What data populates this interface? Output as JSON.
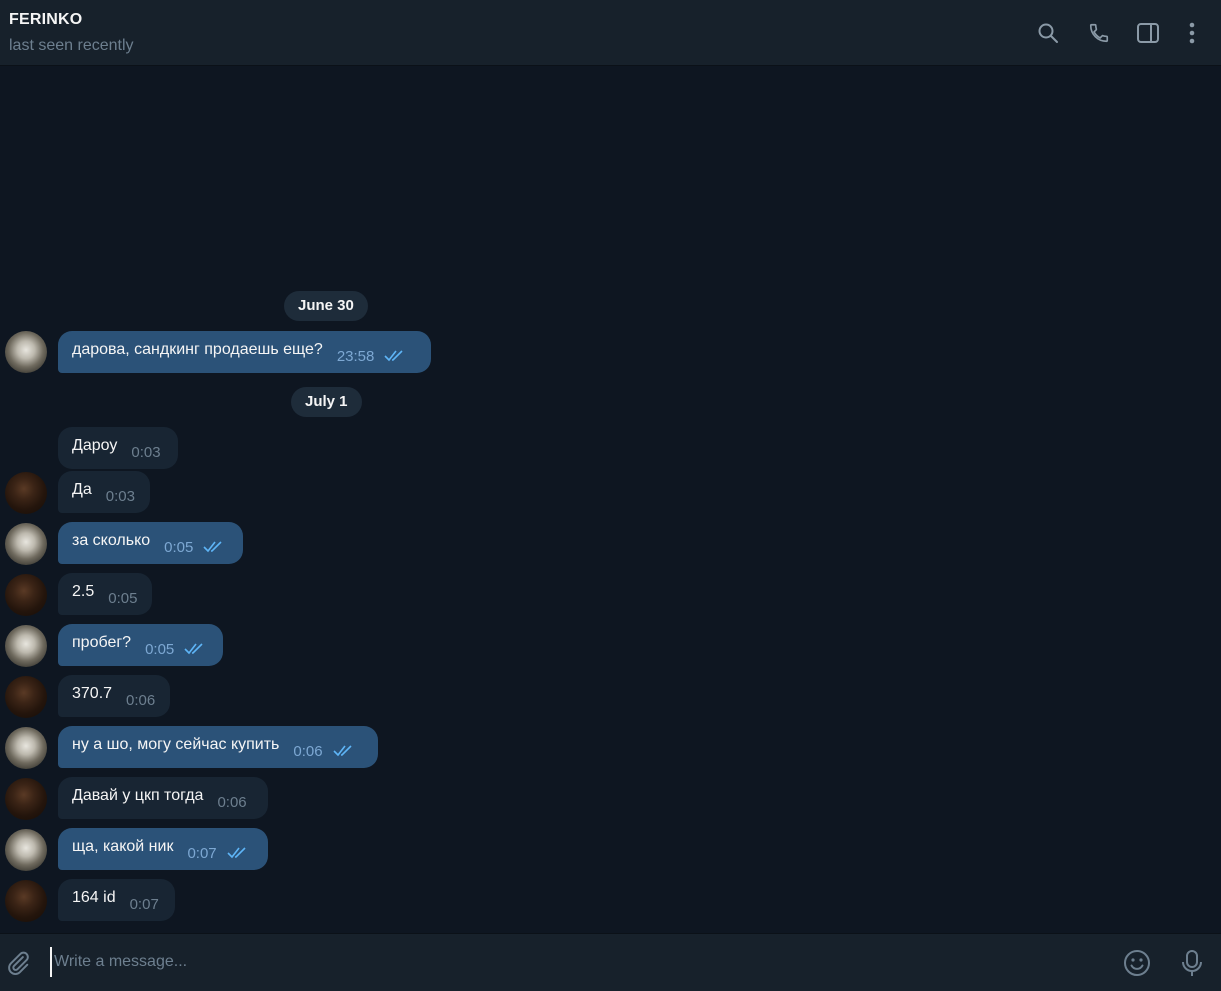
{
  "header": {
    "name": "FERINKO",
    "status": "last seen recently",
    "icons": [
      "search-icon",
      "phone-icon",
      "sidebar-toggle-icon",
      "more-vertical-icon"
    ]
  },
  "dates": {
    "first": "June 30",
    "second": "July 1"
  },
  "messages": [
    {
      "dir": "out",
      "avatar": "cat",
      "text": "дарова, сандкинг продаешь еще?",
      "time": "23:58",
      "read": true
    },
    {
      "dir": "in",
      "avatar": "",
      "text": "Дароу",
      "time": "0:03"
    },
    {
      "dir": "in",
      "avatar": "person",
      "text": "Да",
      "time": "0:03"
    },
    {
      "dir": "out",
      "avatar": "cat",
      "text": "за сколько",
      "time": "0:05",
      "read": true
    },
    {
      "dir": "in",
      "avatar": "person",
      "text": "2.5",
      "time": "0:05"
    },
    {
      "dir": "out",
      "avatar": "cat",
      "text": "пробег?",
      "time": "0:05",
      "read": true
    },
    {
      "dir": "in",
      "avatar": "person",
      "text": "370.7",
      "time": "0:06"
    },
    {
      "dir": "out",
      "avatar": "cat",
      "text": "ну а шо, могу сейчас купить",
      "time": "0:06",
      "read": true
    },
    {
      "dir": "in",
      "avatar": "person",
      "text": "Давай у цкп тогда",
      "time": "0:06"
    },
    {
      "dir": "out",
      "avatar": "cat",
      "text": "ща, какой ник",
      "time": "0:07",
      "read": true
    },
    {
      "dir": "in",
      "avatar": "person",
      "text": "164 id",
      "time": "0:07"
    }
  ],
  "composer": {
    "placeholder": "Write a message...",
    "value": ""
  },
  "colors": {
    "background": "#0e1621",
    "panel": "#17212b",
    "outgoing_bubble": "#2b5278",
    "incoming_bubble": "#182533",
    "accent": "#5eb5f7",
    "muted": "#6d7f8f"
  }
}
